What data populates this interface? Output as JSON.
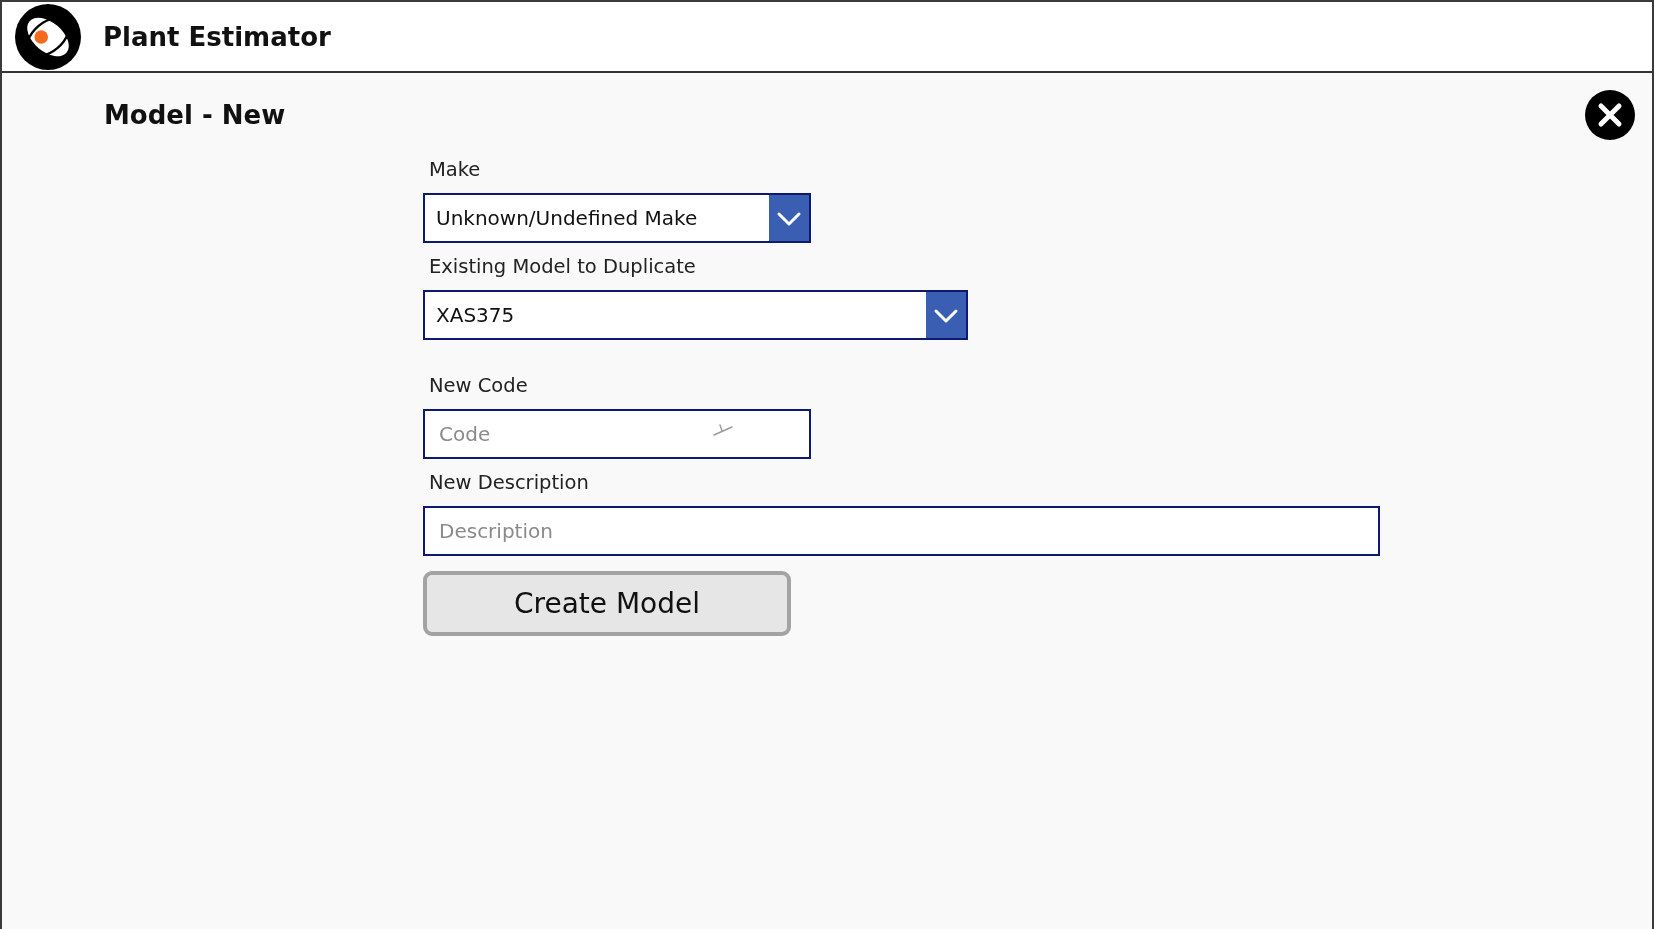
{
  "app": {
    "title": "Plant Estimator"
  },
  "page": {
    "title": "Model - New"
  },
  "form": {
    "fields": [
      {
        "kind": "dropdown",
        "label": "Make",
        "value": "Unknown/Undefined Make"
      },
      {
        "kind": "dropdown",
        "label": "Existing Model to Duplicate",
        "value": "XAS375"
      },
      {
        "kind": "text",
        "label": "New Code",
        "placeholder": "Code"
      },
      {
        "kind": "text",
        "label": "New Description",
        "placeholder": "Description"
      }
    ],
    "submit_button": {
      "label": "Create Model"
    }
  }
}
